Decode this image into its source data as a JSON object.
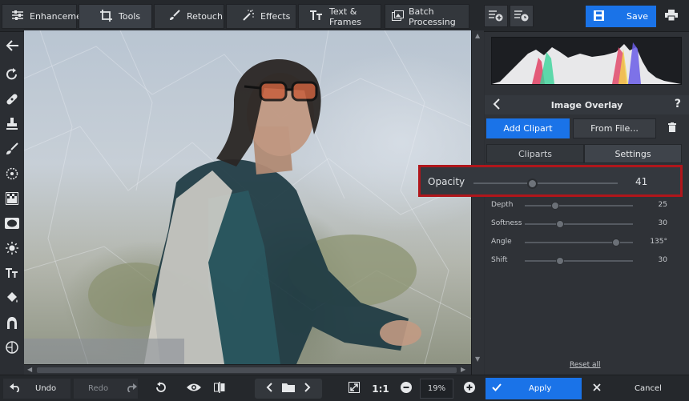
{
  "top_tabs": [
    {
      "label": "Enhancement",
      "icon": "sliders-icon"
    },
    {
      "label": "Tools",
      "icon": "crop-icon"
    },
    {
      "label": "Retouch",
      "icon": "brush-icon"
    },
    {
      "label": "Effects",
      "icon": "magic-wand-icon"
    },
    {
      "label": "Text & Frames",
      "icon": "text-icon"
    },
    {
      "label": "Batch Processing",
      "icon": "images-icon"
    }
  ],
  "active_tab": "Tools",
  "toolbar": {
    "save_label": "Save"
  },
  "panel": {
    "title": "Image Overlay",
    "add_clipart": "Add Clipart",
    "from_file": "From File...",
    "subtabs": [
      "Cliparts",
      "Settings"
    ],
    "active_subtab": "Settings",
    "opacity": {
      "label": "Opacity",
      "value": "41",
      "fraction": 0.41
    },
    "sliders": [
      {
        "label": "Depth",
        "value": "25",
        "fraction": 0.25
      },
      {
        "label": "Softness",
        "value": "30",
        "fraction": 0.3
      },
      {
        "label": "Angle",
        "value": "135°",
        "fraction": 0.84
      },
      {
        "label": "Shift",
        "value": "30",
        "fraction": 0.3
      }
    ],
    "reset_label": "Reset all"
  },
  "bottom": {
    "undo": "Undo",
    "redo": "Redo",
    "zoom_ratio": "1:1",
    "zoom_value": "19%",
    "apply": "Apply",
    "cancel": "Cancel"
  },
  "colors": {
    "accent": "#1a73e8",
    "highlight": "#b0161b"
  }
}
